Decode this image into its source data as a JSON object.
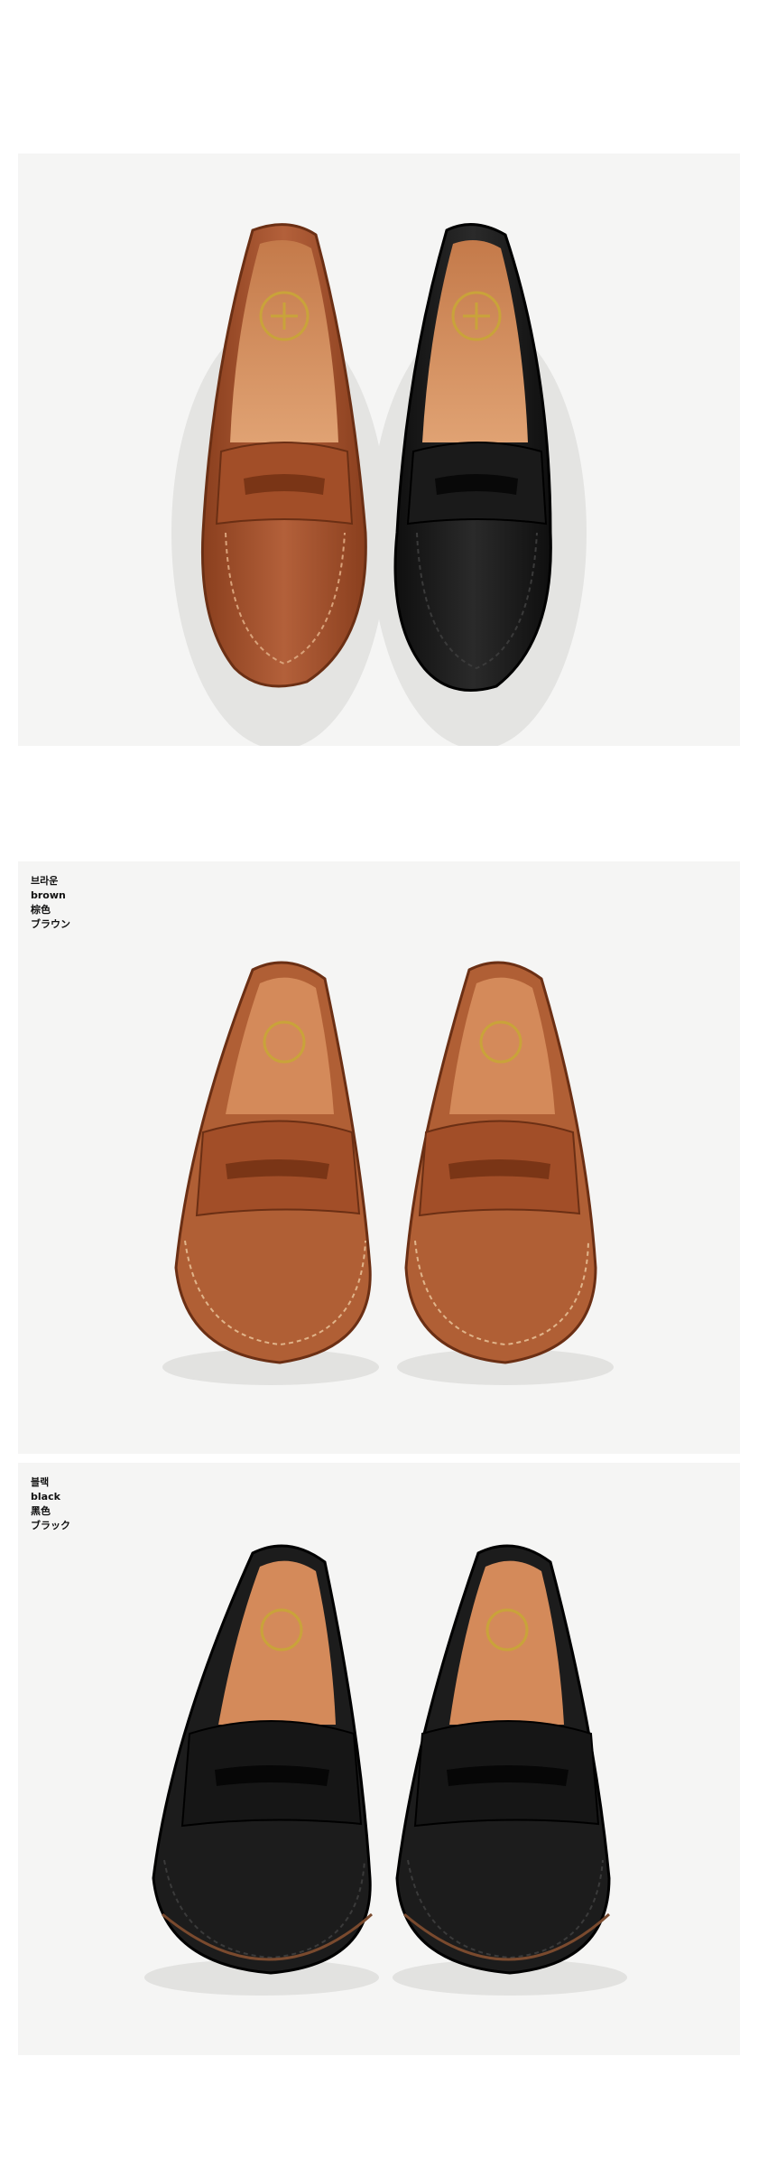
{
  "colors": {
    "page_background": "#ffffff",
    "photo_background": "#f5f5f4",
    "brown_leather": "#a8542c",
    "black_leather": "#1c1c1c",
    "insole": "#d48a5a",
    "logo_gold": "#c9a33a"
  },
  "sections": {
    "brown": {
      "caption_ko": "브라운",
      "caption_en": "brown",
      "caption_zh": "棕色",
      "caption_ja": "ブラウン"
    },
    "black": {
      "caption_ko": "블랙",
      "caption_en": "black",
      "caption_zh": "黑色",
      "caption_ja": "ブラック"
    }
  }
}
